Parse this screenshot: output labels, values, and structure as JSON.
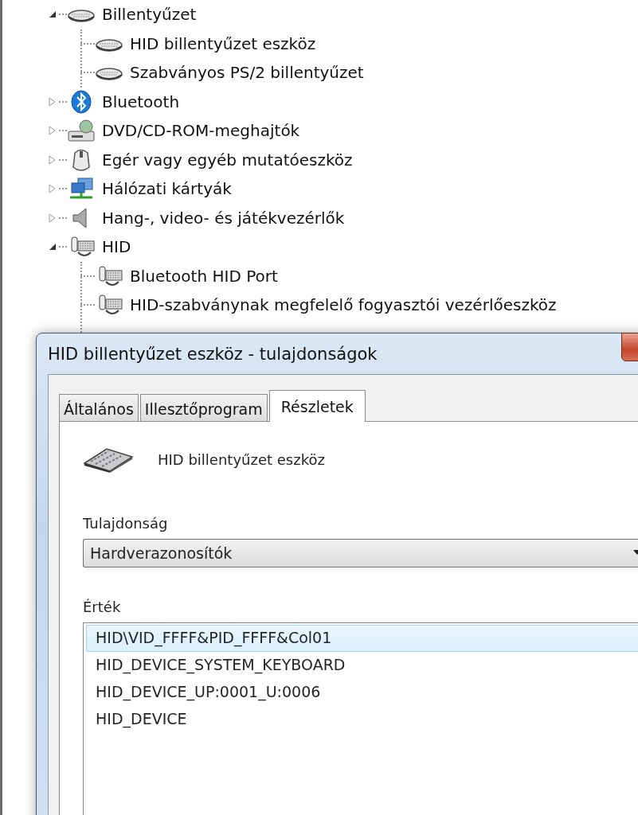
{
  "tree": [
    {
      "label": "Billentyűzet",
      "kind": "keyboard",
      "expanded": true,
      "children": [
        {
          "label": "HID billentyűzet eszköz",
          "kind": "keyboard"
        },
        {
          "label": "Szabványos PS/2 billentyűzet",
          "kind": "keyboard"
        }
      ]
    },
    {
      "label": "Bluetooth",
      "kind": "bluetooth",
      "expanded": false
    },
    {
      "label": "DVD/CD-ROM-meghajtók",
      "kind": "dvd",
      "expanded": false
    },
    {
      "label": "Egér vagy egyéb mutatóeszköz",
      "kind": "mouse",
      "expanded": false
    },
    {
      "label": "Hálózati kártyák",
      "kind": "network",
      "expanded": false
    },
    {
      "label": "Hang-, video- és játékvezérlők",
      "kind": "speaker",
      "expanded": false
    },
    {
      "label": "HID",
      "kind": "hid",
      "expanded": true,
      "children": [
        {
          "label": "Bluetooth HID Port",
          "kind": "hid"
        },
        {
          "label": "HID-szabványnak megfelelő fogyasztói vezérlőeszköz",
          "kind": "hid"
        }
      ]
    }
  ],
  "dialog": {
    "title": "HID billentyűzet eszköz - tulajdonságok",
    "tabs": [
      {
        "label": "Általános",
        "selected": false
      },
      {
        "label": "Illesztőprogram",
        "selected": false
      },
      {
        "label": "Részletek",
        "selected": true
      }
    ],
    "device_name": "HID billentyűzet eszköz",
    "property_label": "Tulajdonság",
    "property_value": "Hardverazonosítók",
    "value_label": "Érték",
    "values": [
      {
        "text": "HID\\VID_FFFF&PID_FFFF&Col01",
        "selected": true
      },
      {
        "text": "HID_DEVICE_SYSTEM_KEYBOARD",
        "selected": false
      },
      {
        "text": "HID_DEVICE_UP:0001_U:0006",
        "selected": false
      },
      {
        "text": "HID_DEVICE",
        "selected": false
      }
    ]
  }
}
